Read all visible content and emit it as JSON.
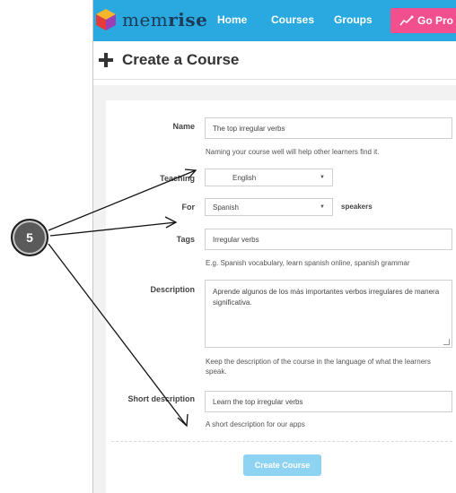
{
  "nav": {
    "logo_prefix": "mem",
    "logo_suffix": "rise",
    "links": [
      "Home",
      "Courses",
      "Groups"
    ],
    "go_pro": "Go Pro"
  },
  "page": {
    "title": "Create a Course"
  },
  "form": {
    "name": {
      "label": "Name",
      "value": "The top irregular verbs",
      "help": "Naming your course well will help other learners find it."
    },
    "teaching": {
      "label": "Teaching",
      "value": "English"
    },
    "for": {
      "label": "For",
      "value": "Spanish",
      "suffix": "speakers"
    },
    "tags": {
      "label": "Tags",
      "value": "Irregular verbs",
      "help": "E.g. Spanish vocabulary, learn spanish online, spanish grammar"
    },
    "description": {
      "label": "Description",
      "value": "Aprende algunos de los más importantes verbos irregulares de manera significativa.",
      "help": "Keep the description of the course in the language of what the learners speak."
    },
    "short_description": {
      "label": "Short description",
      "value": "Learn the top irregular verbs",
      "help": "A short description for our apps"
    },
    "submit": "Create Course"
  },
  "annotation": {
    "step": "5"
  },
  "colors": {
    "nav_bg": "#29a9df",
    "go_pro_bg": "#f14f8d",
    "button_bg": "#8fd3f3"
  }
}
